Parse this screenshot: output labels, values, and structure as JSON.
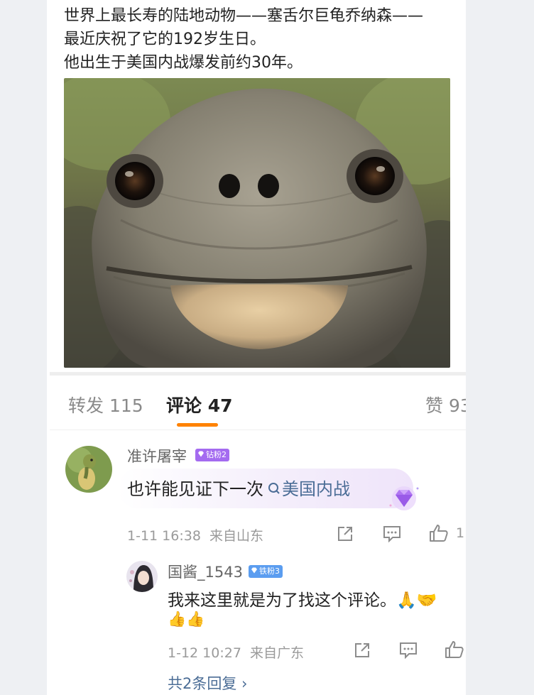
{
  "post": {
    "lines": [
      "世界上最长寿的陆地动物——塞舌尔巨龟乔纳森——",
      "最近庆祝了它的192岁生日。",
      "他出生于美国内战爆发前约30年。"
    ]
  },
  "tabs": {
    "repost": "转发 115",
    "comments": "评论 47",
    "likes": "赞 93"
  },
  "comments": [
    {
      "username": "准许屠宰",
      "badge": "钻粉2",
      "text": "也许能见证下一次",
      "link": "美国内战",
      "time": "1-11 16:38",
      "location": "来自山东",
      "like_count": "1"
    }
  ],
  "replies": [
    {
      "username": "国酱_1543",
      "badge": "铁粉3",
      "text_line1": "我来这里就是为了找这个评论。🙏🤝",
      "text_line2": "👍👍",
      "time": "1-12 10:27",
      "location": "来自广东"
    }
  ],
  "more_replies": "共2条回复 ›",
  "colors": {
    "accent": "#ff8200",
    "link": "#4b6d96",
    "badge_diamond": "#a46bf0",
    "badge_iron": "#5b9df0"
  }
}
